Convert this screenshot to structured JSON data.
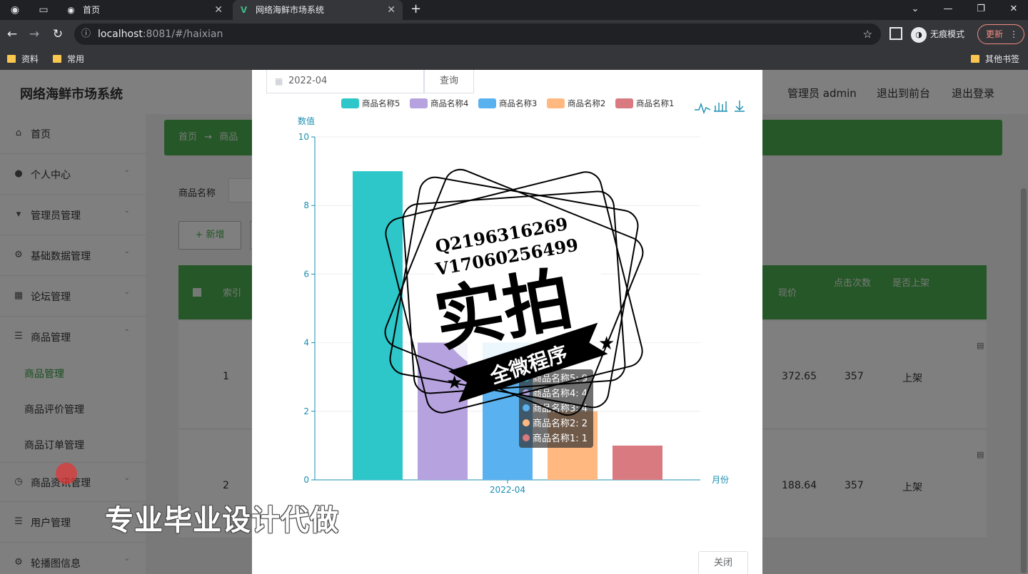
{
  "browser": {
    "tabs": [
      {
        "title": "首页",
        "active": false
      },
      {
        "title": "网络海鲜市场系统",
        "active": true
      }
    ],
    "url_host": "localhost",
    "url_rest": ":8081/#/haixian",
    "incognito_label": "无痕模式",
    "update_label": "更新",
    "bookmarks": [
      "资料",
      "常用"
    ],
    "other_bookmarks": "其他书签"
  },
  "app": {
    "brand": "网络海鲜市场系统",
    "header_links": [
      "管理员 admin",
      "退出到前台",
      "退出登录"
    ],
    "sidebar": {
      "items": [
        {
          "label": "首页",
          "icon": "home-icon"
        },
        {
          "label": "个人中心",
          "icon": "user-icon"
        },
        {
          "label": "管理员管理",
          "icon": "admin-icon"
        },
        {
          "label": "基础数据管理",
          "icon": "settings-icon"
        },
        {
          "label": "论坛管理",
          "icon": "forum-icon"
        },
        {
          "label": "商品管理",
          "icon": "list-icon"
        }
      ],
      "subitems": [
        "商品管理",
        "商品评价管理",
        "商品订单管理"
      ],
      "items2": [
        {
          "label": "商品资讯管理",
          "icon": "clock-icon"
        },
        {
          "label": "用户管理",
          "icon": "list-icon"
        },
        {
          "label": "轮播图信息",
          "icon": "settings-icon"
        }
      ]
    },
    "breadcrumb": {
      "home": "首页",
      "arrow": "→",
      "current": "商品"
    },
    "search_label": "商品名称",
    "add_button": "+ 新增",
    "table": {
      "headers": [
        "索引",
        "现价",
        "点击次数",
        "是否上架"
      ],
      "rows": [
        {
          "index": "1",
          "price": "372.65",
          "clicks": "357",
          "status": "上架"
        },
        {
          "index": "2",
          "price": "188.64",
          "clicks": "357",
          "status": "上架"
        }
      ]
    }
  },
  "dialog": {
    "date_value": "2022-04",
    "query_button": "查询",
    "close_button": "关闭",
    "toolbox": [
      "line-chart-icon",
      "bar-chart-icon",
      "download-icon"
    ],
    "tooltip": [
      {
        "label": "商品名称5: 9",
        "color": "#2ec7c9"
      },
      {
        "label": "商品名称4: 4",
        "color": "#b6a2de"
      },
      {
        "label": "商品名称3: 4",
        "color": "#5ab1ef"
      },
      {
        "label": "商品名称2: 2",
        "color": "#ffb980"
      },
      {
        "label": "商品名称1: 1",
        "color": "#d87a80"
      }
    ]
  },
  "chart_data": {
    "type": "bar",
    "categories": [
      "2022-04"
    ],
    "series": [
      {
        "name": "商品名称5",
        "values": [
          9
        ],
        "color": "#2ec7c9"
      },
      {
        "name": "商品名称4",
        "values": [
          4
        ],
        "color": "#b6a2de"
      },
      {
        "name": "商品名称3",
        "values": [
          4
        ],
        "color": "#5ab1ef"
      },
      {
        "name": "商品名称2",
        "values": [
          2
        ],
        "color": "#ffb980"
      },
      {
        "name": "商品名称1",
        "values": [
          1
        ],
        "color": "#d87a80"
      }
    ],
    "ylabel": "数值",
    "xlabel": "月份",
    "ylim": [
      0,
      10
    ],
    "yticks": [
      "0",
      "2",
      "4",
      "6",
      "8",
      "10"
    ],
    "legend_position": "top",
    "grid": true
  },
  "watermark": {
    "contact1": "Q2196316269",
    "contact2": "V17060256499",
    "stamp_main": "实拍",
    "stamp_banner": "全微程序",
    "caption": "专业毕业设计代做"
  }
}
